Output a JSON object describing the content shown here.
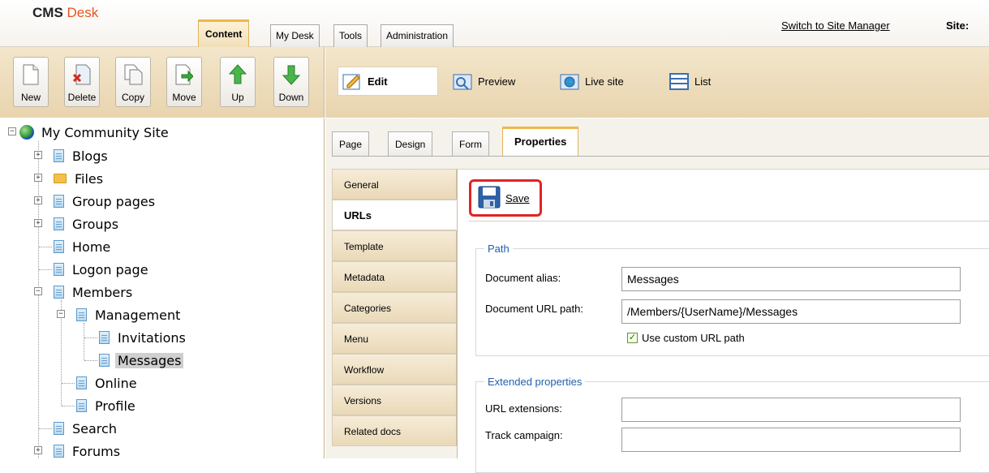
{
  "app": {
    "brand_main": "CMS",
    "brand_accent": "Desk",
    "switch_link": "Switch to Site Manager",
    "site_label": "Site:"
  },
  "main_tabs": [
    {
      "label": "Content",
      "active": true
    },
    {
      "label": "My Desk",
      "active": false
    },
    {
      "label": "Tools",
      "active": false
    },
    {
      "label": "Administration",
      "active": false
    }
  ],
  "toolbar": {
    "buttons": [
      {
        "label": "New",
        "icon": "new-page-icon"
      },
      {
        "label": "Delete",
        "icon": "delete-icon"
      },
      {
        "label": "Copy",
        "icon": "copy-icon"
      },
      {
        "label": "Move",
        "icon": "move-icon"
      },
      {
        "label": "Up",
        "icon": "arrow-up-icon"
      },
      {
        "label": "Down",
        "icon": "arrow-down-icon"
      }
    ]
  },
  "view_modes": [
    {
      "label": "Edit",
      "icon": "edit-icon",
      "active": true
    },
    {
      "label": "Preview",
      "icon": "preview-icon",
      "active": false
    },
    {
      "label": "Live site",
      "icon": "live-site-icon",
      "active": false
    },
    {
      "label": "List",
      "icon": "list-icon",
      "active": false
    }
  ],
  "tree": {
    "root": "My Community Site",
    "nodes": [
      {
        "label": "Blogs"
      },
      {
        "label": "Files"
      },
      {
        "label": "Group pages"
      },
      {
        "label": "Groups"
      },
      {
        "label": "Home"
      },
      {
        "label": "Logon page"
      },
      {
        "label": "Members"
      },
      {
        "label": "Management"
      },
      {
        "label": "Invitations"
      },
      {
        "label": "Messages",
        "selected": true
      },
      {
        "label": "Online"
      },
      {
        "label": "Profile"
      },
      {
        "label": "Search"
      },
      {
        "label": "Forums"
      }
    ]
  },
  "sub_tabs": [
    {
      "label": "Page"
    },
    {
      "label": "Design"
    },
    {
      "label": "Form"
    },
    {
      "label": "Properties",
      "active": true
    }
  ],
  "vertical_tabs": [
    {
      "label": "General"
    },
    {
      "label": "URLs",
      "active": true
    },
    {
      "label": "Template"
    },
    {
      "label": "Metadata"
    },
    {
      "label": "Categories"
    },
    {
      "label": "Menu"
    },
    {
      "label": "Workflow"
    },
    {
      "label": "Versions"
    },
    {
      "label": "Related docs"
    }
  ],
  "save": {
    "label": "Save"
  },
  "path_group": {
    "legend": "Path",
    "alias_label": "Document alias:",
    "alias_value": "Messages",
    "url_path_label": "Document URL path:",
    "url_path_value": "/Members/{UserName}/Messages",
    "custom_path_label": "Use custom URL path",
    "custom_path_checked": true
  },
  "extended_group": {
    "legend": "Extended properties",
    "url_ext_label": "URL extensions:",
    "url_ext_value": "",
    "track_label": "Track campaign:",
    "track_value": ""
  },
  "colors": {
    "accent_orange": "#f0b74c",
    "toolbar_bg": "#ecdcbc",
    "legend_blue": "#2060b0",
    "highlight_red": "#e02424"
  }
}
